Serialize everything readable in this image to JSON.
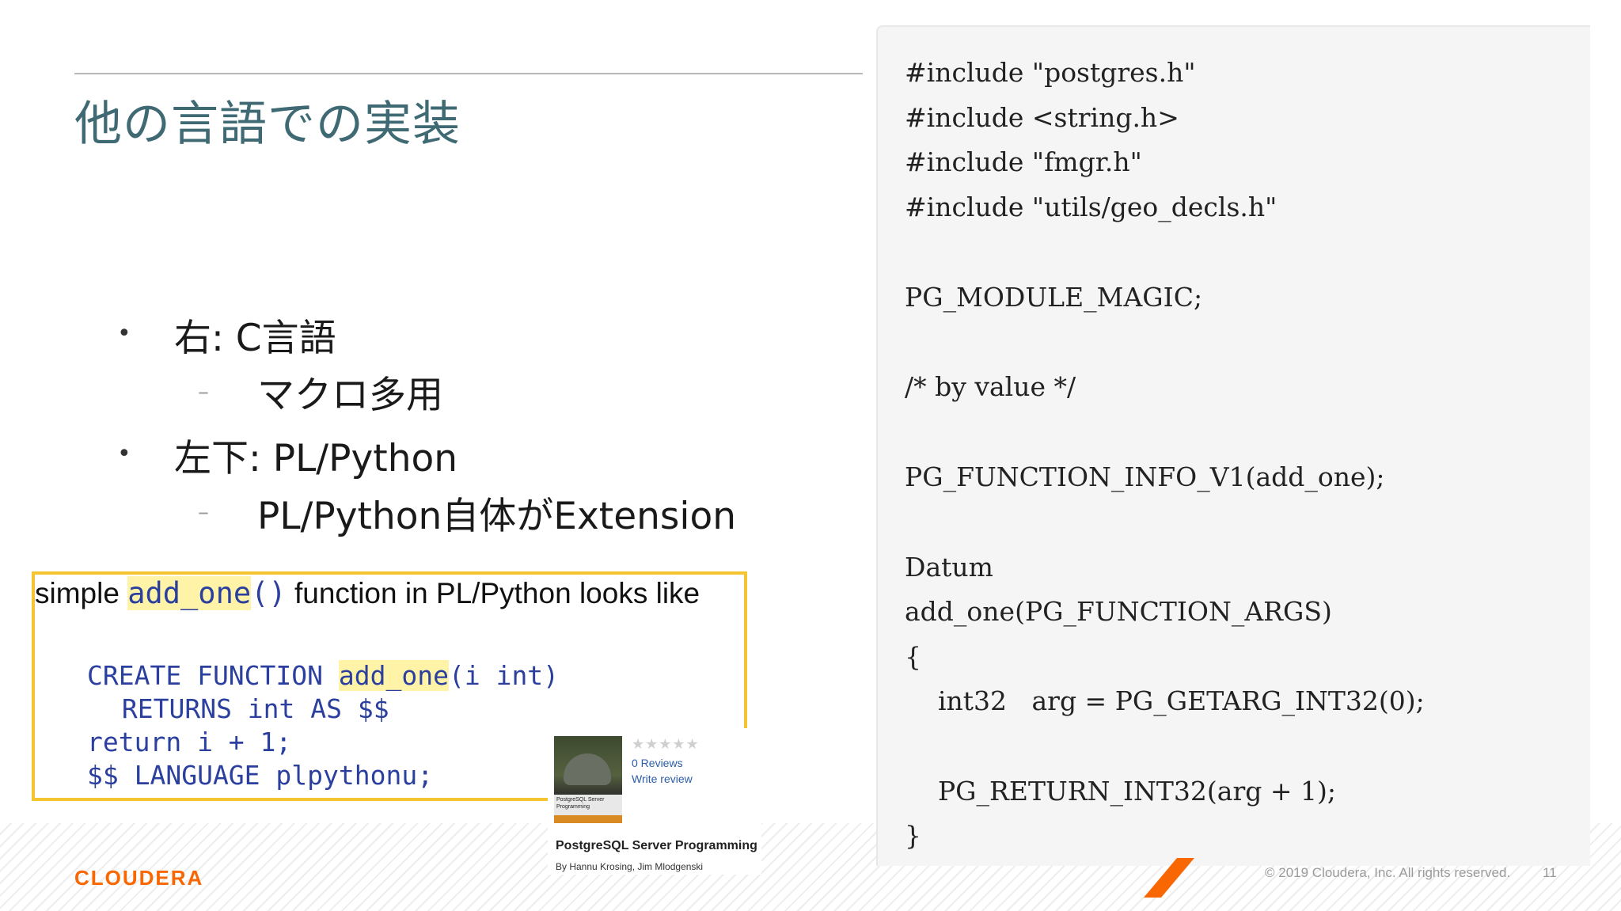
{
  "slide": {
    "title": "他の言語での実装",
    "bullets": [
      {
        "text": "右: C言語",
        "sub": "マクロ多用"
      },
      {
        "text": "左下: PL/Python",
        "sub": "PL/Python自体がExtension"
      }
    ],
    "bullet_glyph": "•",
    "sub_glyph": "–"
  },
  "c_code": {
    "lines": [
      "#include \"postgres.h\"",
      "#include <string.h>",
      "#include \"fmgr.h\"",
      "#include \"utils/geo_decls.h\"",
      "PG_MODULE_MAGIC;",
      "/* by value */",
      "PG_FUNCTION_INFO_V1(add_one);",
      "Datum",
      "add_one(PG_FUNCTION_ARGS)",
      "{",
      "    int32   arg = PG_GETARG_INT32(0);",
      "    PG_RETURN_INT32(arg + 1);",
      "}"
    ]
  },
  "pl_python": {
    "caption_pre": "simple ",
    "caption_func": "add_one",
    "caption_parens": "()",
    "caption_post": " function in PL/Python looks like",
    "line1_a": "CREATE FUNCTION ",
    "line1_func": "add_one",
    "line1_b": "(i int)",
    "line2": " RETURNS int AS $$",
    "line3": "return i + 1;",
    "line4": "$$ LANGUAGE plpythonu;"
  },
  "book": {
    "stars": "★★★★★",
    "reviews": "0 Reviews",
    "write_review": "Write review",
    "cover_text": "PostgreSQL Server Programming",
    "title": "PostgreSQL Server Programming",
    "authors": "By Hannu Krosing, Jim Mlodgenski"
  },
  "footer": {
    "logo": "CLOUDERA",
    "copyright": "© 2019 Cloudera, Inc. All rights reserved.",
    "page_number": "11"
  },
  "colors": {
    "title": "#3f6a74",
    "accent": "#f96702",
    "box_border": "#f5c431",
    "code_blue": "#2b3f9e",
    "highlight": "#fff3a8",
    "code_panel_bg": "#f5f5f5"
  }
}
